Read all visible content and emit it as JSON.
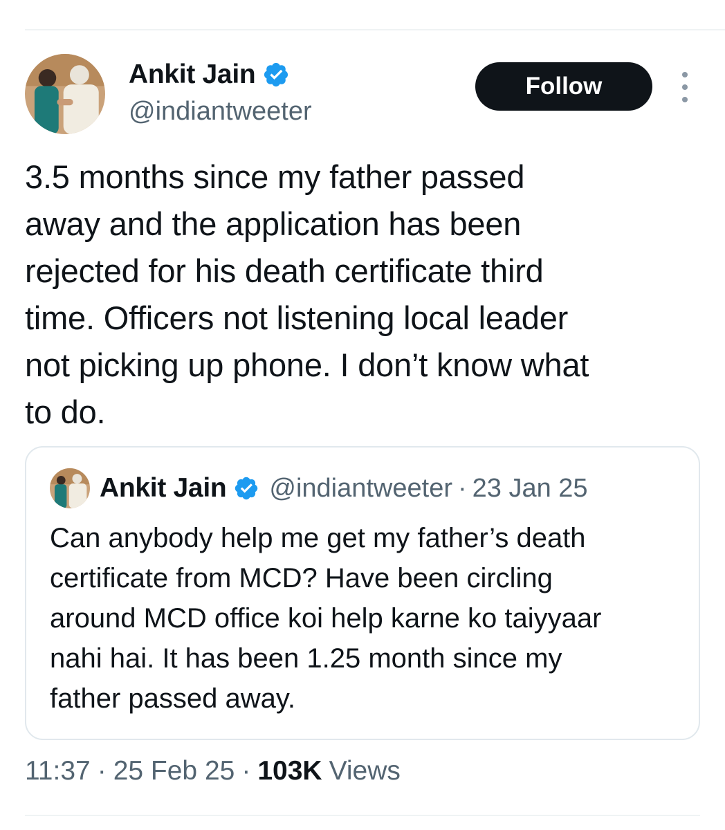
{
  "author": {
    "name": "Ankit Jain",
    "handle": "@indiantweeter"
  },
  "follow_label": "Follow",
  "tweet": {
    "text": "3.5 months since my father passed\naway and the application has been\nrejected for his death certificate third\ntime. Officers not listening local leader\nnot picking up phone. I don’t know what\nto do."
  },
  "quoted": {
    "name": "Ankit Jain",
    "handle": "@indiantweeter",
    "separator": "·",
    "date": "23 Jan 25",
    "text": "Can anybody help me get my father’s death\ncertificate from MCD? Have been circling\naround MCD office koi help karne ko taiyyaar\nnahi hai. It has been 1.25 month since my\nfather passed away."
  },
  "meta": {
    "time": "11:37",
    "separator": "·",
    "date": "25 Feb 25",
    "views_count": "103K",
    "views_label": "Views"
  },
  "icons": {
    "verified": "verified-badge-icon",
    "more": "more-vertical-icon"
  },
  "colors": {
    "verified_blue": "#1d9bf0",
    "text_primary": "#0f1419",
    "text_secondary": "#536471",
    "button_bg": "#0f1419"
  }
}
